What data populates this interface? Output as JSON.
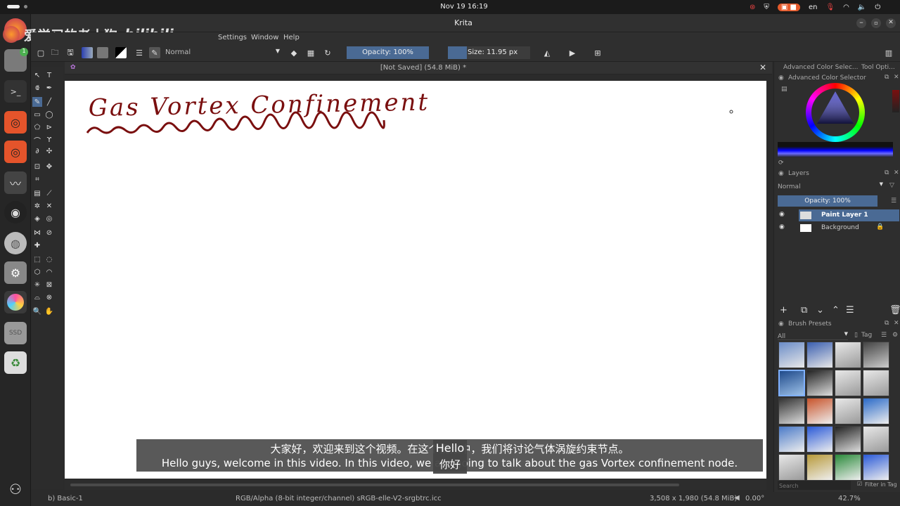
{
  "system": {
    "datetime": "Nov 19  16:19",
    "lang": "en"
  },
  "window": {
    "title": "Krita"
  },
  "watermark": {
    "text": "爱学习的老土狗"
  },
  "menu": {
    "items": [
      "Settings",
      "Window",
      "Help"
    ]
  },
  "toolbar": {
    "blend_mode": "Normal",
    "opacity": "Opacity: 100%",
    "size": "Size: 11.95 px"
  },
  "document": {
    "tab_title": "[Not Saved]  (54.8 MiB) *",
    "handwriting": "Gas Vortex Confinement"
  },
  "panels": {
    "color_tabs": [
      "Advanced Color Selec...",
      "Tool Opti..."
    ],
    "color_title": "Advanced Color Selector",
    "layers_title": "Layers",
    "layers_blend": "Normal",
    "layers_opacity": "Opacity: 100%",
    "layers": [
      {
        "name": "Paint Layer 1",
        "active": true
      },
      {
        "name": "Background",
        "active": false
      }
    ],
    "brush_title": "Brush Presets",
    "brush_filter": "All",
    "brush_tag": "Tag",
    "search_placeholder": "Search",
    "filter_in_tag": "Filter in Tag"
  },
  "subtitles": {
    "zh": "大家好，欢迎来到这个视频。在这个视频中，我们将讨论气体涡旋约束节点。",
    "en": "Hello guys, welcome in this video. In this video, we are going to talk about the gas Vortex confinement node.",
    "popup_en": "Hello",
    "popup_zh": "你好"
  },
  "status": {
    "brush": "b) Basic-1",
    "color_space": "RGB/Alpha (8-bit integer/channel)  sRGB-elle-V2-srgbtrc.icc",
    "dimensions": "3,508 x 1,980 (54.8 MiB)",
    "rotation": "0.00°",
    "zoom": "42.7%"
  },
  "colors": {
    "accent": "#4a6a94",
    "ink": "#7a0f0f",
    "dock_active": "#3a3a3a"
  }
}
